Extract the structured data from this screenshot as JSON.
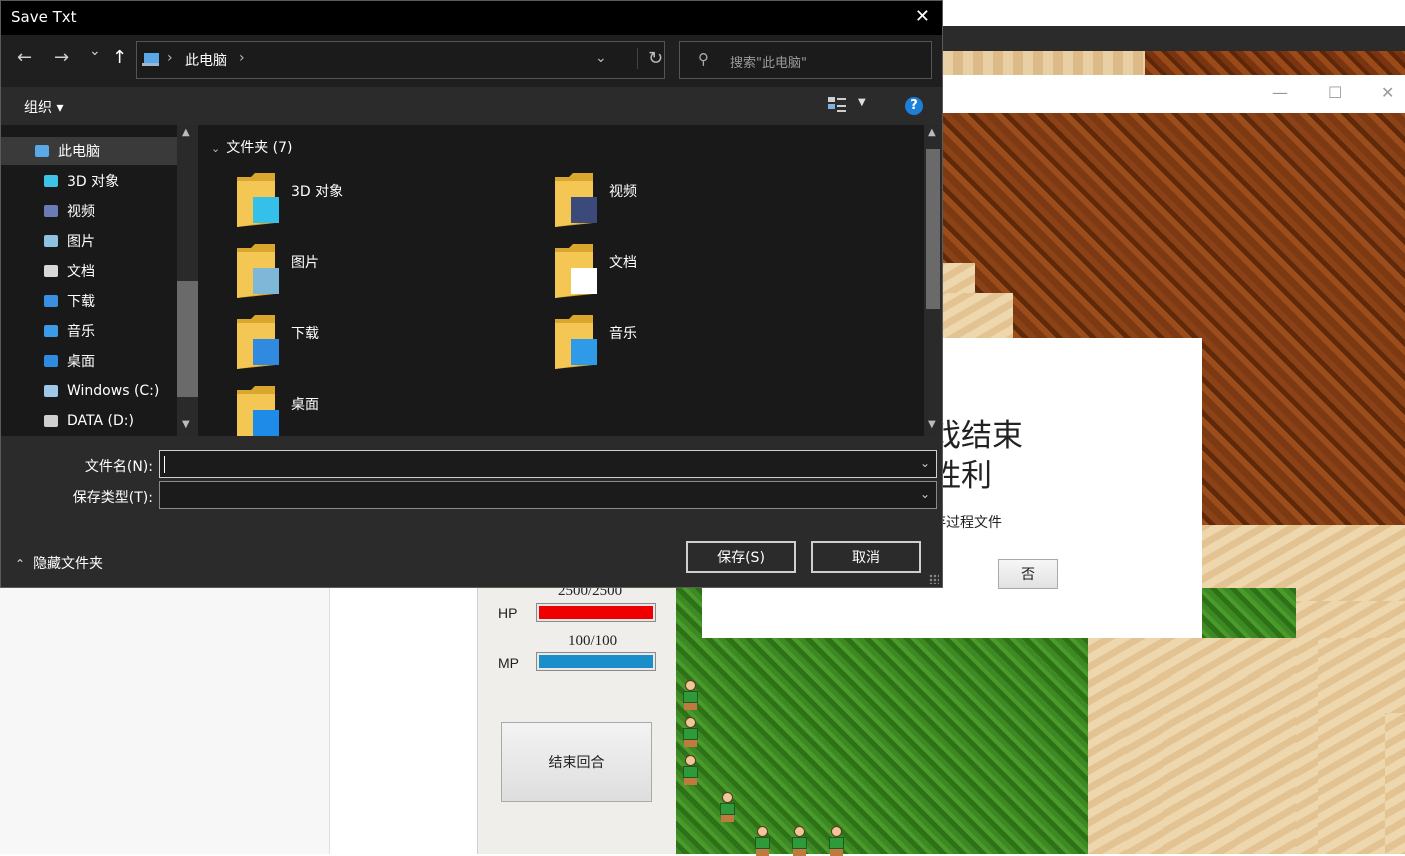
{
  "dialog": {
    "title": "Save Txt",
    "close_glyph": "✕"
  },
  "nav": {
    "back_glyph": "←",
    "forward_glyph": "→",
    "recent_glyph": "⌄",
    "up_glyph": "↑",
    "breadcrumb_sep": "›",
    "breadcrumb": "此电脑",
    "address_dropdown_glyph": "⌄",
    "refresh_glyph": "↻",
    "search_placeholder": "搜索\"此电脑\"",
    "search_glyph": "⚲"
  },
  "toolbar": {
    "organize": "组织 ▾",
    "view_dropdown_glyph": "▼",
    "help": "?"
  },
  "tree": {
    "items": [
      {
        "label": "此电脑",
        "icon": "pc-icon",
        "color": "#5aa9e6"
      },
      {
        "label": "3D 对象",
        "icon": "3d-objects-icon",
        "color": "#3fc2e8"
      },
      {
        "label": "视频",
        "icon": "videos-icon",
        "color": "#6a7bb5"
      },
      {
        "label": "图片",
        "icon": "pictures-icon",
        "color": "#8fc1e0"
      },
      {
        "label": "文档",
        "icon": "documents-icon",
        "color": "#d8d8d8"
      },
      {
        "label": "下载",
        "icon": "downloads-icon",
        "color": "#3b8fe0"
      },
      {
        "label": "音乐",
        "icon": "music-icon",
        "color": "#3b9be8"
      },
      {
        "label": "桌面",
        "icon": "desktop-icon",
        "color": "#2f8be0"
      },
      {
        "label": "Windows (C:)",
        "icon": "drive-c-icon",
        "color": "#9fc7e8"
      },
      {
        "label": "DATA (D:)",
        "icon": "drive-d-icon",
        "color": "#cfcfcf"
      }
    ]
  },
  "content": {
    "group_header": "文件夹 (7)",
    "folders": [
      {
        "label": "3D 对象",
        "icon": "3d-objects-folder-icon",
        "overlay": "#35c0ea"
      },
      {
        "label": "视频",
        "icon": "videos-folder-icon",
        "overlay": "#3b4a7a"
      },
      {
        "label": "图片",
        "icon": "pictures-folder-icon",
        "overlay": "#7fb7d8"
      },
      {
        "label": "文档",
        "icon": "documents-folder-icon",
        "overlay": "#ffffff"
      },
      {
        "label": "下载",
        "icon": "downloads-folder-icon",
        "overlay": "#2f8ae0"
      },
      {
        "label": "音乐",
        "icon": "music-folder-icon",
        "overlay": "#2f9ae8"
      },
      {
        "label": "桌面",
        "icon": "desktop-folder-icon",
        "overlay": "#1f8be8"
      }
    ]
  },
  "form": {
    "filename_label": "文件名(N):",
    "filename_value": "",
    "filetype_label": "保存类型(T):",
    "filetype_value": "",
    "dropdown_glyph": "⌄",
    "hide_folders": "隐藏文件夹",
    "hide_folders_glyph": "⌃",
    "save_button": "保存(S)",
    "cancel_button": "取消"
  },
  "game": {
    "window_controls": {
      "minimize": "—",
      "maximize": "☐",
      "close": "✕"
    },
    "hp_value": "2500/2500",
    "hp_label": "HP",
    "hp_fraction": 1.0,
    "hp_color": "#ee0000",
    "mp_value": "100/100",
    "mp_label": "MP",
    "mp_fraction": 1.0,
    "mp_color": "#1a8ec8",
    "end_turn_button": "结束回合",
    "message_line1": "戏结束",
    "message_line2": "胜利",
    "message_line3": "存过程文件",
    "no_button": "否"
  }
}
